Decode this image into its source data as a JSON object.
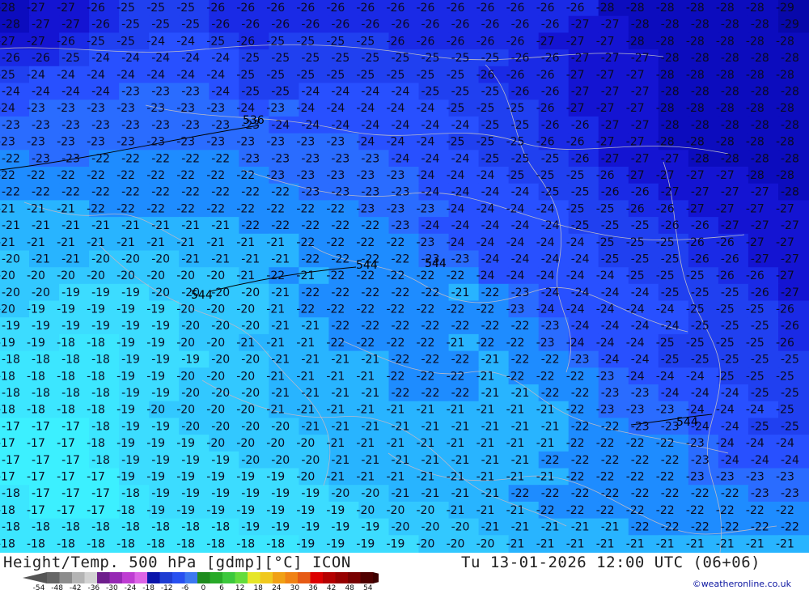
{
  "footer": {
    "title_left": "Height/Temp. 500 hPa [gdmp][°C] ICON",
    "title_right": "Tu 13-01-2026 12:00 UTC (06+06)",
    "credit": "©weatheronline.co.uk"
  },
  "color_scale": {
    "labels": [
      "-54",
      "-48",
      "-42",
      "-36",
      "-30",
      "-24",
      "-18",
      "-12",
      "-6",
      "0",
      "6",
      "12",
      "18",
      "24",
      "30",
      "36",
      "42",
      "48",
      "54"
    ],
    "colors": [
      "#666666",
      "#8c8c8c",
      "#b4b4b4",
      "#d2d2d2",
      "#6e1e8c",
      "#9628b4",
      "#be3cd2",
      "#dc64e6",
      "#0a14aa",
      "#1e3cd2",
      "#2850f0",
      "#3c78f0",
      "#1e8c1e",
      "#28aa28",
      "#3cc83c",
      "#64dc3c",
      "#e6e628",
      "#f0c81e",
      "#f0a014",
      "#f08214",
      "#e65a14",
      "#dc0000",
      "#b40000",
      "#960000",
      "#780000",
      "#500000"
    ]
  },
  "map": {
    "temp_colors": {
      "-17": "#3cf0ff",
      "-18": "#3ce6ff",
      "-19": "#3cdcff",
      "-20": "#32c8ff",
      "-21": "#28b4ff",
      "-22": "#1e8cff",
      "-23": "#2a6cff",
      "-24": "#2850ff",
      "-25": "#2040f0",
      "-26": "#1a2ae6",
      "-27": "#1414d2",
      "-28": "#0c0cbe",
      "-29": "#0808aa"
    },
    "height_labels": [
      "544",
      "544",
      "544",
      "536",
      "544"
    ],
    "temp_rows": [
      "-28-27-27-26-25-25-25-26-26-26-26-26-26-26-26-26-26-26-26-26-28-28-28-28-28-28-29",
      "-28-27-27-26-25-25-25-26-26-26-26-26-26-26-26-26-26-26-26-27-27-28-28-28-28-28-29",
      "-27-27-26-25-25-24-24-25-26-25-25-25-25-26-26-26-26-26-27-27-27-28-28-28-28-28-28",
      "-26-26-25-24-24-24-24-24-25-25-25-25-25-25-25-25-25-26-26-27-27-27-28-28-28-28-28",
      "-25-24-24-24-24-24-24-24-25-25-25-25-25-25-25-25-26-26-26-27-27-27-28-28-28-28-28",
      "-24-24-24-24-23-23-23-24-25-25-24-24-24-24-25-25-25-26-26-27-27-27-28-28-28-28-28",
      "-24-23-23-23-23-23-23-23-24-23-24-24-24-24-24-25-25-25-26-27-27-27-28-28-28-28-28",
      "-23-23-23-23-23-23-23-23-23-24-24-24-24-24-24-24-25-25-26-26-27-27-28-28-28-28-28",
      "-23-23-23-23-23-23-23-23-23-23-23-23-24-24-24-25-25-25-26-26-27-27-28-28-28-28-28",
      "-22-23-23-22-22-22-22-22-23-23-23-23-23-24-24-24-25-25-25-26-27-27-27-28-28-28-28",
      "-22-22-22-22-22-22-22-22-22-23-23-23-23-23-24-24-24-25-25-25-26-27-27-27-27-28-28",
      "-22-22-22-22-22-22-22-22-22-22-23-23-23-23-24-24-24-24-25-25-26-26-27-27-27-27-28",
      "-21-21-21-22-22-22-22-22-22-22-22-22-23-23-23-24-24-24-24-25-25-26-26-27-27-27-27",
      "-21-21-21-21-21-21-21-21-22-22-22-22-22-23-24-24-24-24-24-25-25-25-26-26-27-27-27",
      "-21-21-21-21-21-21-21-21-21-21-22-22-22-22-23-24-24-24-24-24-25-25-25-26-26-27-27",
      "-20-21-21-20-20-20-21-21-21-21-22-22-22-22-23-23-24-24-24-24-25-25-25-26-26-27-27",
      "-20-20-20-20-20-20-20-20-21-22-21-22-22-22-22-22-24-24-24-24-24-25-25-25-26-26-27",
      "-20-20-19-19-19-20-20-20-20-21-22-22-22-22-22-21-22-23-24-24-24-24-25-25-25-26-27",
      "-20-19-19-19-19-19-20-20-20-21-22-22-22-22-22-22-22-23-24-24-24-24-24-25-25-25-26",
      "-19-19-19-19-19-19-20-20-20-21-21-22-22-22-22-22-22-22-23-24-24-24-24-25-25-25-26",
      "-19-19-18-18-19-19-20-20-21-21-21-22-22-22-22-21-22-22-23-24-24-24-25-25-25-25-26",
      "-18-18-18-18-19-19-19-20-20-21-21-21-21-22-22-22-21-22-22-23-24-24-25-25-25-25-25",
      "-18-18-18-18-19-19-20-20-20-21-21-21-21-22-22-22-21-22-22-22-23-24-24-24-25-25-25",
      "-18-18-18-18-19-19-20-20-20-21-21-21-21-22-22-22-21-21-22-22-23-23-24-24-24-25-25",
      "-18-18-18-18-19-20-20-20-20-21-21-21-21-21-21-21-21-21-21-22-23-23-23-24-24-24-25",
      "-17-17-17-18-19-19-20-20-20-20-21-21-21-21-21-21-21-21-21-22-22-23-23-24-24-25-25",
      "-17-17-17-18-19-19-19-20-20-20-20-21-21-21-21-21-21-21-21-22-22-22-22-23-24-24-24",
      "-17-17-17-18-19-19-19-19-20-20-20-21-21-21-21-21-21-21-22-22-22-22-22-23-24-24-24",
      "-17-17-17-17-19-19-19-19-19-19-20-21-21-21-21-21-21-21-21-22-22-22-22-23-23-23-23",
      "-18-17-17-17-18-19-19-19-19-19-19-20-20-21-21-21-21-22-22-22-22-22-22-22-22-23-23",
      "-18-17-17-17-18-19-19-19-19-19-19-19-20-20-20-21-21-21-22-22-22-22-22-22-22-22-22",
      "-18-18-18-18-18-18-18-18-19-19-19-19-19-20-20-20-21-21-21-21-21-22-22-22-22-22-22",
      "-18-18-18-18-18-18-18-18-18-18-19-19-19-19-20-20-20-21-21-21-21-21-21-21-21-21-21"
    ]
  }
}
